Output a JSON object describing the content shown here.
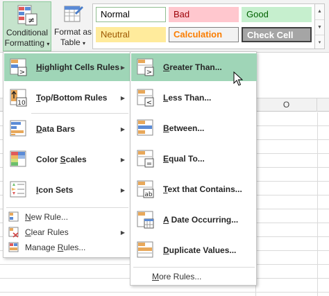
{
  "ribbon": {
    "conditional_formatting": {
      "line1": "Conditional",
      "line2": "Formatting"
    },
    "format_as_table": {
      "line1": "Format as",
      "line2": "Table"
    },
    "cell_styles": [
      {
        "label": "Normal",
        "bg": "#ffffff",
        "color": "#000000",
        "border": "#8fbc8f"
      },
      {
        "label": "Bad",
        "bg": "#ffc7ce",
        "color": "#9c0006",
        "border": "#ffc7ce"
      },
      {
        "label": "Good",
        "bg": "#c6efce",
        "color": "#006100",
        "border": "#c6efce"
      },
      {
        "label": "Neutral",
        "bg": "#ffeb9c",
        "color": "#9c5700",
        "border": "#ffeb9c"
      },
      {
        "label": "Calculation",
        "bg": "#f2f2f2",
        "color": "#fa7d00",
        "border": "#7f7f7f"
      },
      {
        "label": "Check Cell",
        "bg": "#a5a5a5",
        "color": "#ffffff",
        "border": "#3f3f3f"
      }
    ]
  },
  "sheet": {
    "column_header": "O"
  },
  "menu": {
    "items": [
      {
        "pre": "",
        "u": "H",
        "post": "ighlight Cells Rules",
        "icon": "highlight-cells-icon"
      },
      {
        "pre": "",
        "u": "T",
        "post": "op/Bottom Rules",
        "icon": "top-bottom-icon"
      },
      {
        "pre": "",
        "u": "D",
        "post": "ata Bars",
        "icon": "data-bars-icon"
      },
      {
        "pre": "Color ",
        "u": "S",
        "post": "cales",
        "icon": "color-scales-icon"
      },
      {
        "pre": "",
        "u": "I",
        "post": "con Sets",
        "icon": "icon-sets-icon"
      }
    ],
    "small_items": [
      {
        "pre": "",
        "u": "N",
        "post": "ew Rule..."
      },
      {
        "pre": "",
        "u": "C",
        "post": "lear Rules"
      },
      {
        "pre": "Manage ",
        "u": "R",
        "post": "ules..."
      }
    ]
  },
  "submenu": {
    "items": [
      {
        "pre": "",
        "u": "G",
        "post": "reater Than..."
      },
      {
        "pre": "",
        "u": "L",
        "post": "ess Than..."
      },
      {
        "pre": "",
        "u": "B",
        "post": "etween..."
      },
      {
        "pre": "",
        "u": "E",
        "post": "qual To..."
      },
      {
        "pre": "",
        "u": "T",
        "post": "ext that Contains..."
      },
      {
        "pre": "",
        "u": "A",
        "post": " Date Occurring..."
      },
      {
        "pre": "",
        "u": "D",
        "post": "uplicate Values..."
      }
    ],
    "more": {
      "pre": "",
      "u": "M",
      "post": "ore Rules..."
    }
  },
  "colors": {
    "highlight": "#9fd5b7",
    "ribbon_active": "#c5e3cc"
  }
}
